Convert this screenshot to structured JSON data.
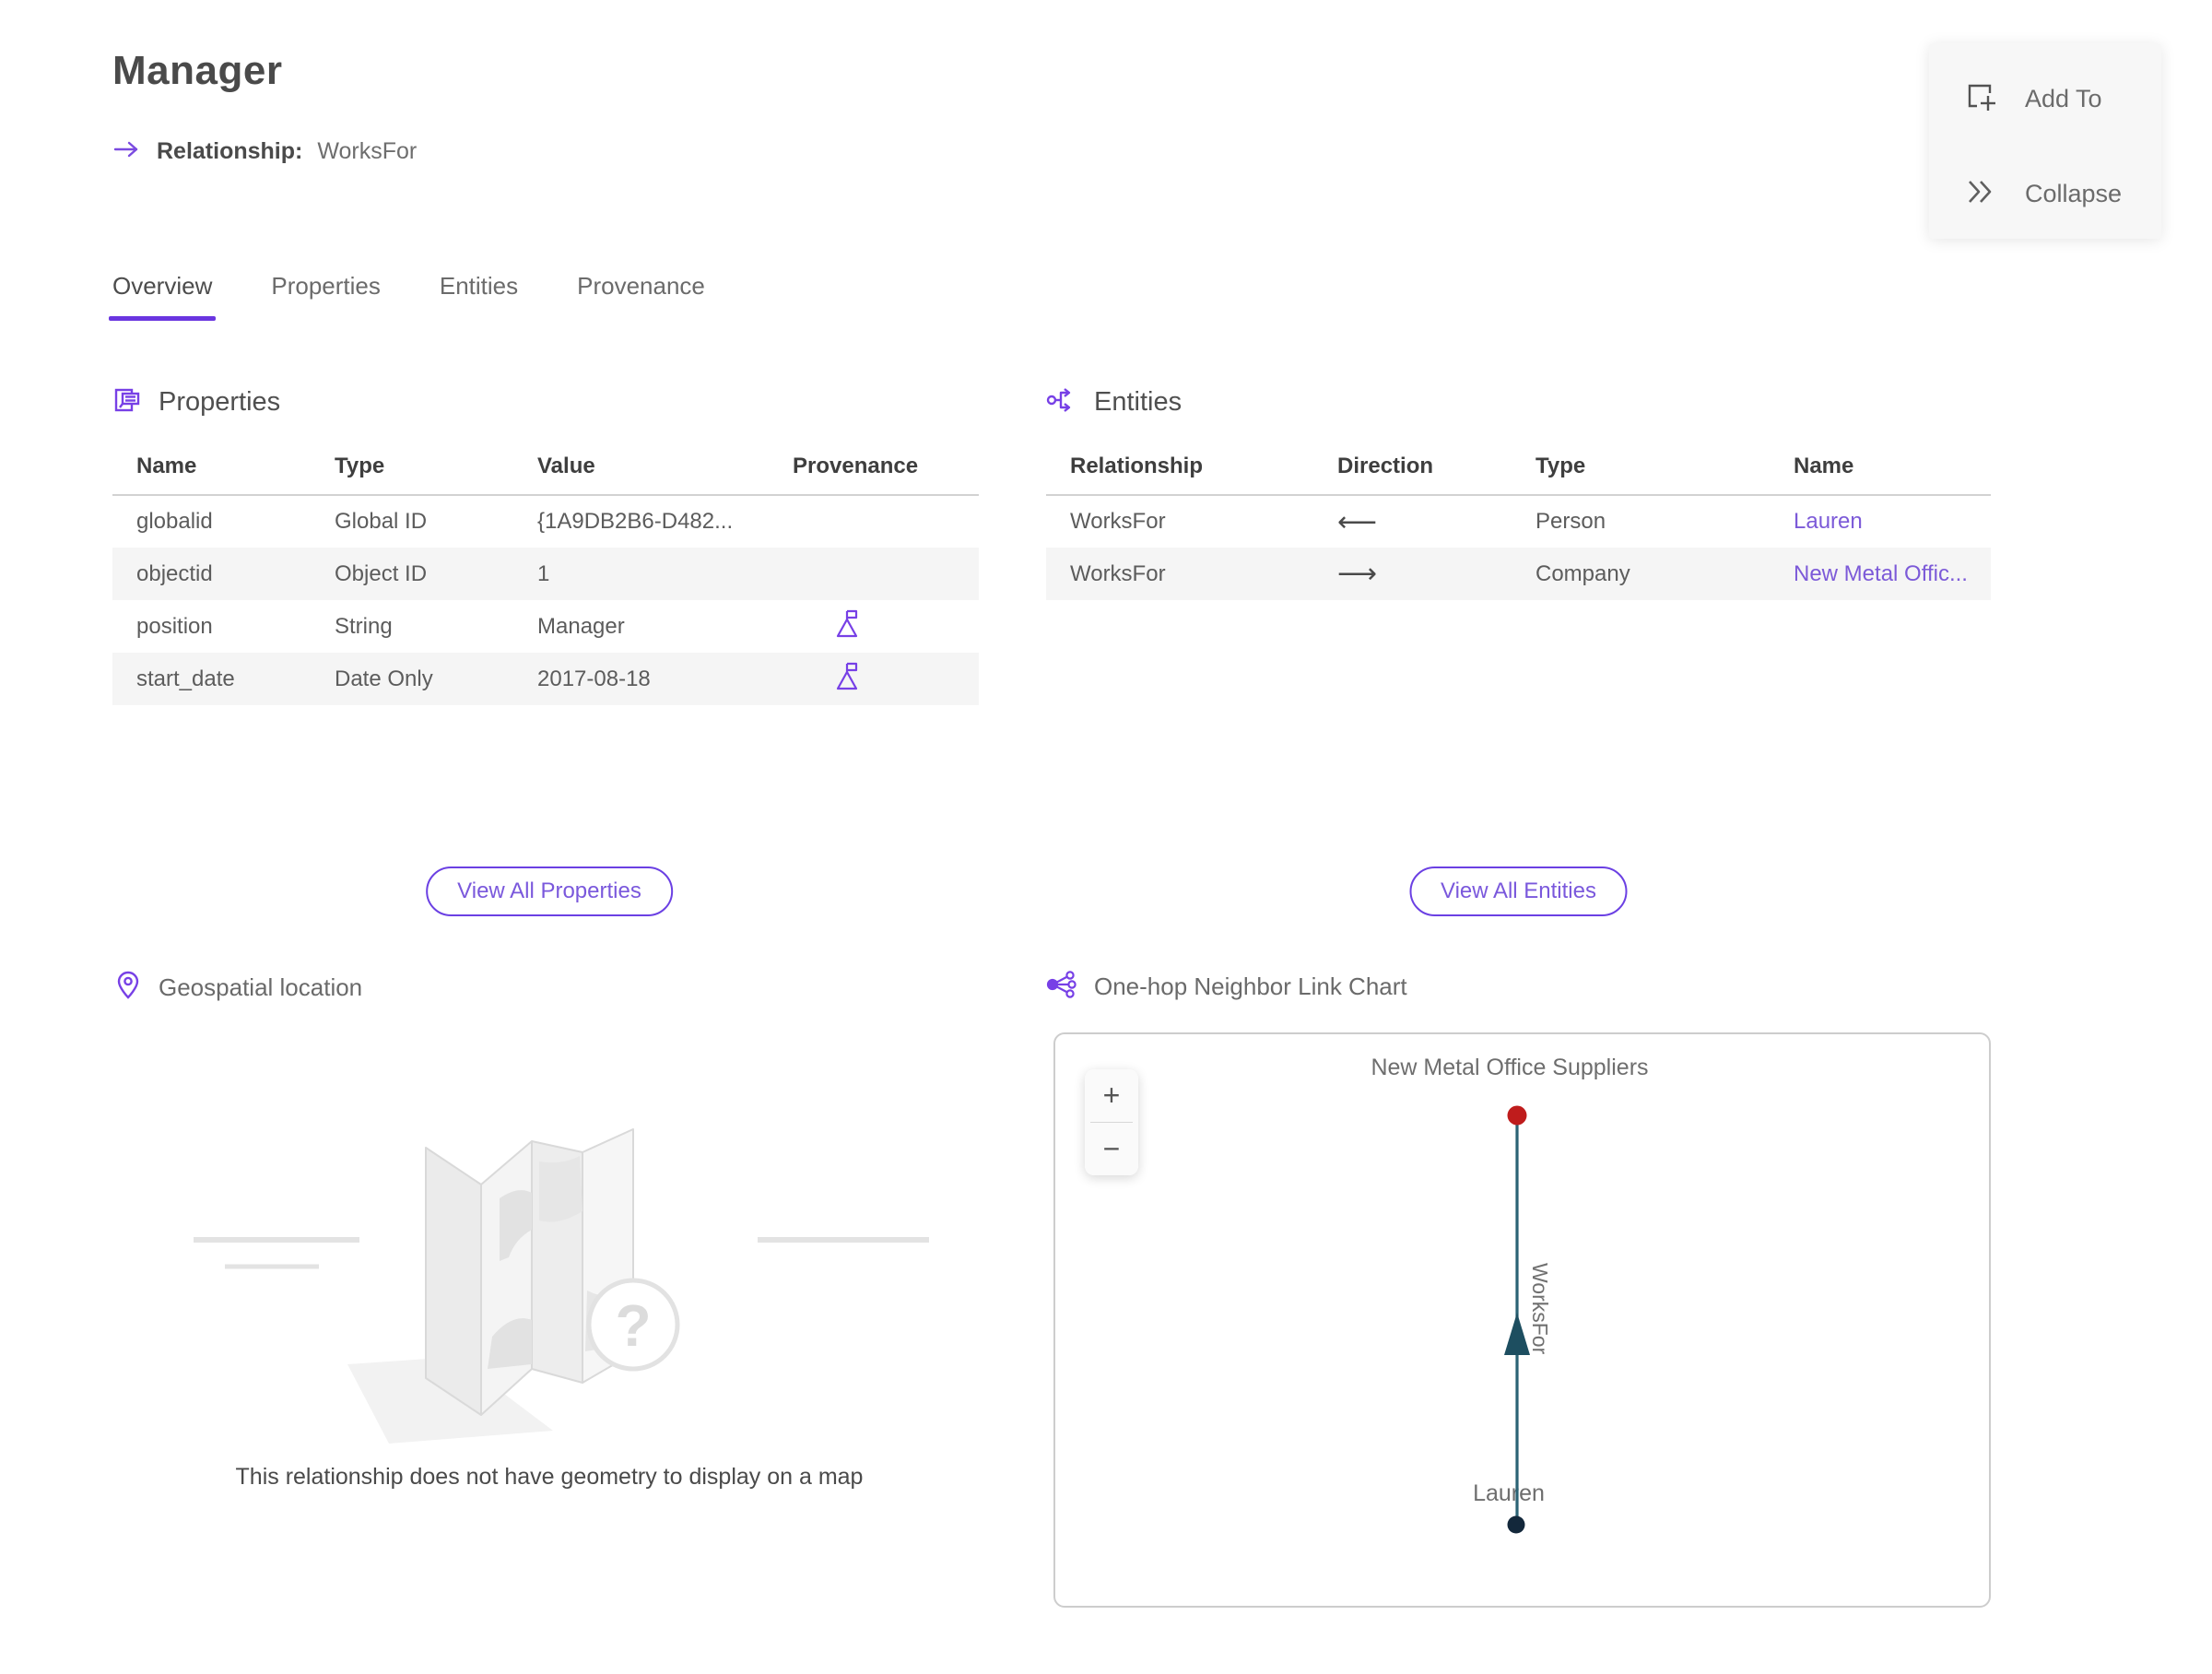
{
  "page": {
    "title": "Manager",
    "type_label": "Relationship:",
    "type_value": "WorksFor"
  },
  "actions": {
    "add_to_label": "Add To",
    "collapse_label": "Collapse"
  },
  "tabs": {
    "items": [
      {
        "label": "Overview",
        "active": true
      },
      {
        "label": "Properties",
        "active": false
      },
      {
        "label": "Entities",
        "active": false
      },
      {
        "label": "Provenance",
        "active": false
      }
    ]
  },
  "properties_section": {
    "title": "Properties",
    "columns": [
      "Name",
      "Type",
      "Value",
      "Provenance"
    ],
    "rows": [
      {
        "name": "globalid",
        "type": "Global ID",
        "value": "{1A9DB2B6-D482...",
        "provenance_flag": false
      },
      {
        "name": "objectid",
        "type": "Object ID",
        "value": "1",
        "provenance_flag": false
      },
      {
        "name": "position",
        "type": "String",
        "value": "Manager",
        "provenance_flag": true
      },
      {
        "name": "start_date",
        "type": "Date Only",
        "value": "2017-08-18",
        "provenance_flag": true
      }
    ],
    "view_all_label": "View All Properties"
  },
  "entities_section": {
    "title": "Entities",
    "columns": [
      "Relationship",
      "Direction",
      "Type",
      "Name"
    ],
    "rows": [
      {
        "relationship": "WorksFor",
        "direction": "⟵",
        "type": "Person",
        "name": "Lauren"
      },
      {
        "relationship": "WorksFor",
        "direction": "⟶",
        "type": "Company",
        "name": "New Metal Offic..."
      }
    ],
    "view_all_label": "View All Entities"
  },
  "geospatial_section": {
    "title": "Geospatial location",
    "empty_message": "This relationship does not have geometry to display on a map"
  },
  "link_chart_section": {
    "title": "One-hop Neighbor Link Chart",
    "zoom_in_label": "+",
    "zoom_out_label": "−",
    "chart_data": {
      "type": "node-link",
      "nodes": [
        {
          "label": "New Metal Office Suppliers",
          "entity_type": "Company",
          "color": "#bf1c1c",
          "position": "top"
        },
        {
          "label": "Lauren",
          "entity_type": "Person",
          "color": "#13283b",
          "position": "bottom"
        }
      ],
      "edges": [
        {
          "label": "WorksFor",
          "from": "Lauren",
          "to": "New Metal Office Suppliers",
          "color": "#2b6375",
          "direction": "up"
        }
      ]
    }
  },
  "colors": {
    "accent_purple": "#6a35e0",
    "icon_purple": "#7740e6",
    "link_purple": "#7c5ad8",
    "tab_underline": "#6a35e0",
    "edge_teal": "#2b6375",
    "arrow_teal": "#1d4e60",
    "node_red": "#bf1c1c",
    "node_navy": "#13283b"
  }
}
